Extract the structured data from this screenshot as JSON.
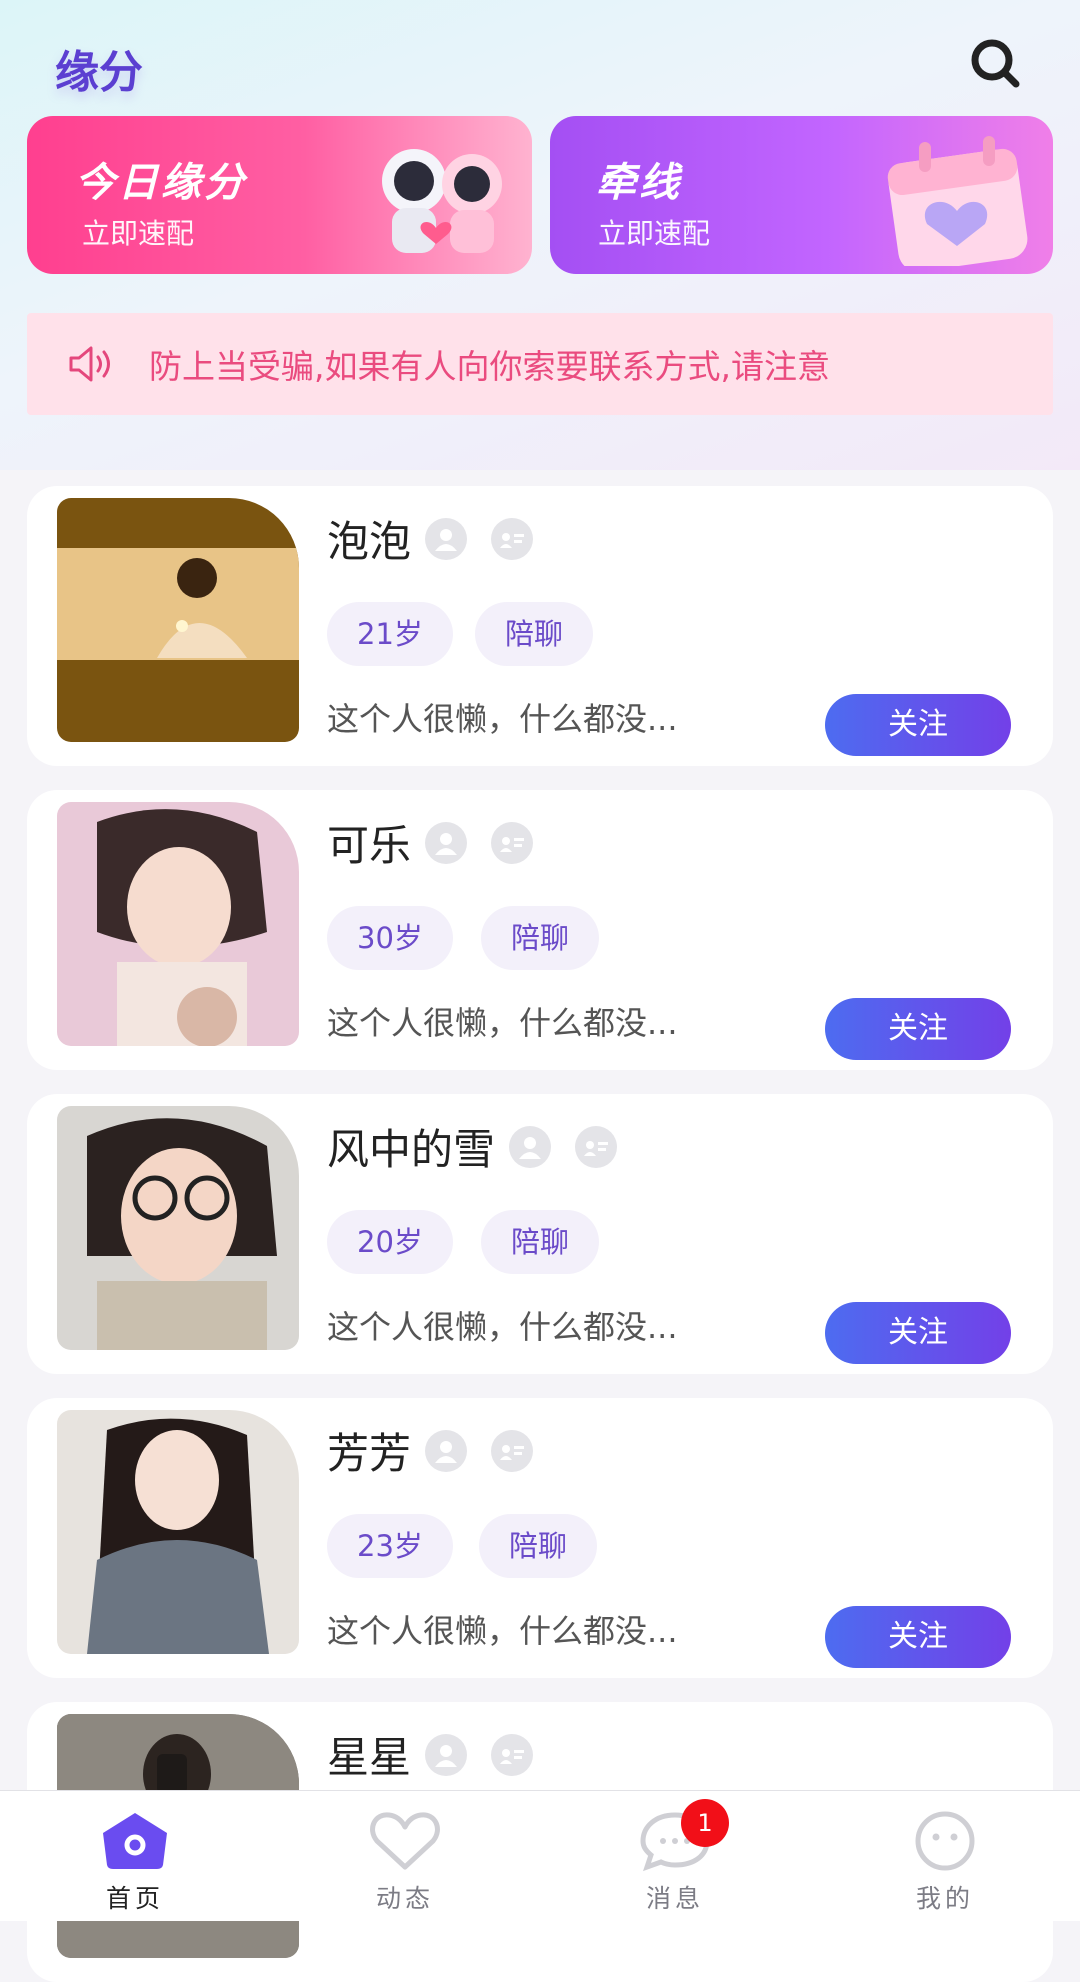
{
  "header": {
    "title": "缘分",
    "search_icon": "search-icon"
  },
  "banners": [
    {
      "title": "今日缘分",
      "subtitle": "立即速配",
      "color": "#ff4a95"
    },
    {
      "title": "牵线",
      "subtitle": "立即速配",
      "color": "#b659f9"
    }
  ],
  "notice": {
    "icon": "speaker-icon",
    "text": "防上当受骗,如果有人向你索要联系方式,请注意"
  },
  "users": [
    {
      "name": "泡泡",
      "age": "21岁",
      "tag": "陪聊",
      "bio": "这个人很懒，什么都没...",
      "follow_label": "关注"
    },
    {
      "name": "可乐",
      "age": "30岁",
      "tag": "陪聊",
      "bio": "这个人很懒，什么都没...",
      "follow_label": "关注"
    },
    {
      "name": "风中的雪",
      "age": "20岁",
      "tag": "陪聊",
      "bio": "这个人很懒，什么都没...",
      "follow_label": "关注"
    },
    {
      "name": "芳芳",
      "age": "23岁",
      "tag": "陪聊",
      "bio": "这个人很懒，什么都没...",
      "follow_label": "关注"
    },
    {
      "name": "星星",
      "age": "",
      "tag": "",
      "bio": "",
      "follow_label": ""
    }
  ],
  "tabs": [
    {
      "label": "首页",
      "active": true
    },
    {
      "label": "动态",
      "active": false
    },
    {
      "label": "消息",
      "active": false,
      "badge": "1"
    },
    {
      "label": "我的",
      "active": false
    }
  ],
  "colors": {
    "accent": "#5b3fd1",
    "follow_gradient_start": "#4d6cf0",
    "follow_gradient_end": "#7340e8",
    "badge": "#f20f18"
  }
}
